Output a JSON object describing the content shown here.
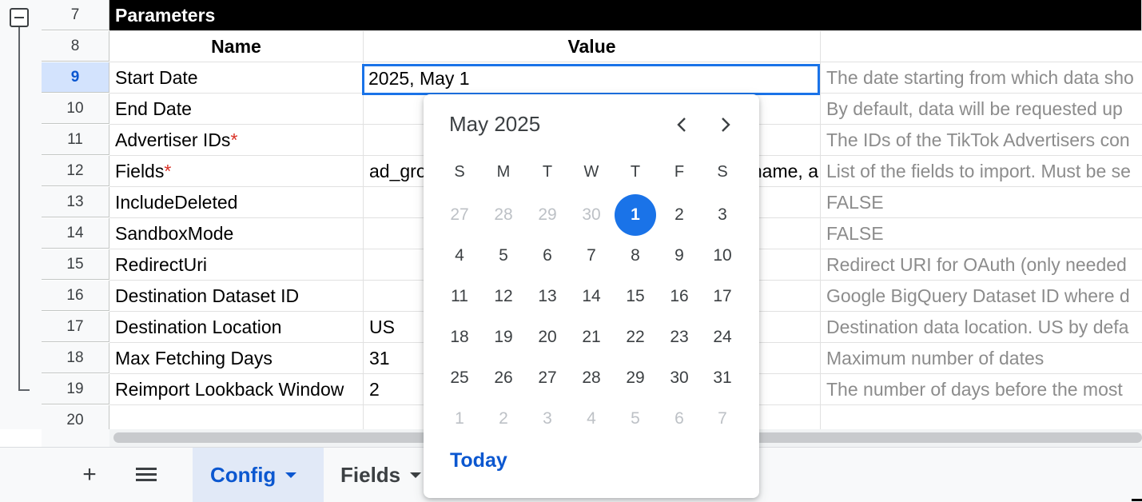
{
  "grid": {
    "param_row": {
      "num": "7",
      "title": "Parameters"
    },
    "header_row": {
      "num": "8",
      "name": "Name",
      "value": "Value"
    },
    "rows": [
      {
        "num": "9",
        "name": "Start Date",
        "req": "",
        "value": "2025, May 1",
        "desc": "The date starting from which data sho"
      },
      {
        "num": "10",
        "name": "End Date",
        "req": "",
        "value": "",
        "desc": "By default, data will be requested up"
      },
      {
        "num": "11",
        "name": "Advertiser IDs",
        "req": "*",
        "value": "",
        "desc": "The IDs of the TikTok Advertisers con"
      },
      {
        "num": "12",
        "name": "Fields",
        "req": "*",
        "value": "ad_gro",
        "value_tail": "name, a",
        "desc": "List of the fields to import. Must be se"
      },
      {
        "num": "13",
        "name": "IncludeDeleted",
        "req": "",
        "value": "",
        "desc": "FALSE"
      },
      {
        "num": "14",
        "name": "SandboxMode",
        "req": "",
        "value": "",
        "desc": "FALSE"
      },
      {
        "num": "15",
        "name": "RedirectUri",
        "req": "",
        "value": "",
        "desc": "Redirect URI for OAuth (only needed"
      },
      {
        "num": "16",
        "name": "Destination Dataset ID",
        "req": "",
        "value": "",
        "desc": "Google BigQuery Dataset ID where d"
      },
      {
        "num": "17",
        "name": "Destination Location",
        "req": "",
        "value": "US",
        "desc": "Destination data location. US by defa"
      },
      {
        "num": "18",
        "name": "Max Fetching Days",
        "req": "",
        "value": "31",
        "desc": "Maximum number of dates"
      },
      {
        "num": "19",
        "name": "Reimport Lookback Window",
        "req": "",
        "value": "2",
        "desc": "The number of days before the most"
      },
      {
        "num": "20",
        "name": "",
        "req": "",
        "value": "",
        "desc": ""
      }
    ]
  },
  "selected_cell": {
    "value": "2025, May 1"
  },
  "datepicker": {
    "month_label": "May 2025",
    "prev_icon": "chevron-left-icon",
    "next_icon": "chevron-right-icon",
    "weekdays": [
      "S",
      "M",
      "T",
      "W",
      "T",
      "F",
      "S"
    ],
    "weeks": [
      [
        {
          "d": "27",
          "muted": true
        },
        {
          "d": "28",
          "muted": true
        },
        {
          "d": "29",
          "muted": true
        },
        {
          "d": "30",
          "muted": true
        },
        {
          "d": "1",
          "selected": true
        },
        {
          "d": "2"
        },
        {
          "d": "3"
        }
      ],
      [
        {
          "d": "4"
        },
        {
          "d": "5"
        },
        {
          "d": "6"
        },
        {
          "d": "7"
        },
        {
          "d": "8"
        },
        {
          "d": "9"
        },
        {
          "d": "10"
        }
      ],
      [
        {
          "d": "11"
        },
        {
          "d": "12"
        },
        {
          "d": "13"
        },
        {
          "d": "14"
        },
        {
          "d": "15"
        },
        {
          "d": "16"
        },
        {
          "d": "17"
        }
      ],
      [
        {
          "d": "18"
        },
        {
          "d": "19"
        },
        {
          "d": "20"
        },
        {
          "d": "21"
        },
        {
          "d": "22"
        },
        {
          "d": "23"
        },
        {
          "d": "24"
        }
      ],
      [
        {
          "d": "25"
        },
        {
          "d": "26"
        },
        {
          "d": "27"
        },
        {
          "d": "28"
        },
        {
          "d": "29"
        },
        {
          "d": "30"
        },
        {
          "d": "31"
        }
      ],
      [
        {
          "d": "1",
          "muted": true
        },
        {
          "d": "2",
          "muted": true
        },
        {
          "d": "3",
          "muted": true
        },
        {
          "d": "4",
          "muted": true
        },
        {
          "d": "5",
          "muted": true
        },
        {
          "d": "6",
          "muted": true
        },
        {
          "d": "7",
          "muted": true
        }
      ]
    ],
    "today_label": "Today",
    "accent": "#1a73e8"
  },
  "tabs": {
    "add_icon": "plus-icon",
    "menu_icon": "menu-icon",
    "sheets": [
      {
        "label": "Config",
        "active": true
      },
      {
        "label": "Fields",
        "active": false
      }
    ]
  }
}
